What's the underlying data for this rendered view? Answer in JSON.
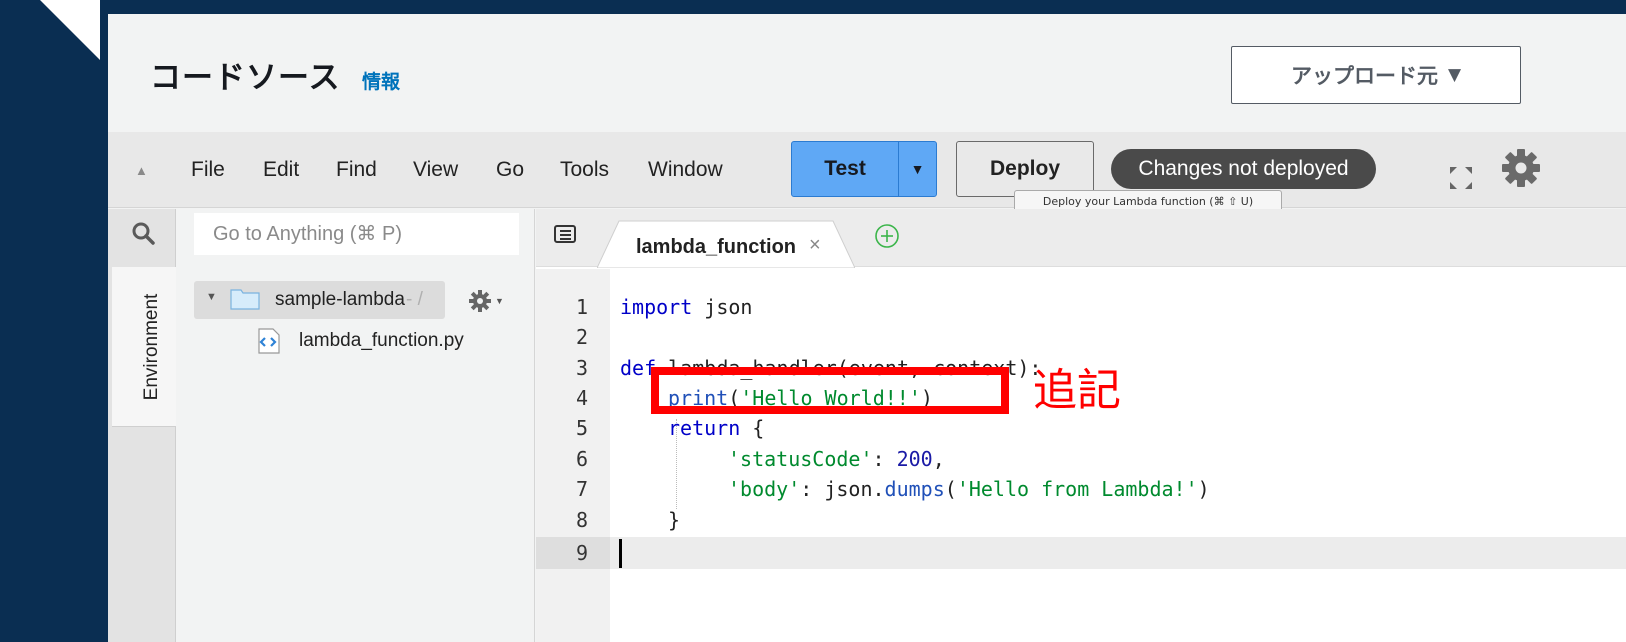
{
  "header": {
    "title": "コードソース",
    "info_link": "情報",
    "upload_label": "アップロード元"
  },
  "menu": [
    "File",
    "Edit",
    "Find",
    "View",
    "Go",
    "Tools",
    "Window"
  ],
  "toolbar": {
    "test_label": "Test",
    "deploy_label": "Deploy",
    "status_badge": "Changes not deployed",
    "deploy_tooltip": "Deploy your Lambda function (⌘ ⇧ U)"
  },
  "sidebar": {
    "environment_tab": "Environment",
    "goto_placeholder": "Go to Anything (⌘ P)"
  },
  "filetree": {
    "folder_name": "sample-lambda",
    "folder_suffix": "- /",
    "file_name": "lambda_function.py"
  },
  "editor": {
    "tab_label": "lambda_function",
    "tab_close": "×",
    "line_numbers": [
      "1",
      "2",
      "3",
      "4",
      "5",
      "6",
      "7",
      "8",
      "9"
    ],
    "code": {
      "l1_kw": "import",
      "l1_rest": " json",
      "l3_kw": "def",
      "l3_rest": " lambda_handler(event, context):",
      "l4_fn": "print",
      "l4_open": "(",
      "l4_str": "'Hello World!!'",
      "l4_close": ")",
      "l5_kw": "return",
      "l5_rest": " {",
      "l6_str": "'statusCode'",
      "l6_colon": ": ",
      "l6_num": "200",
      "l6_comma": ",",
      "l7_str": "'body'",
      "l7_mid": ": json.",
      "l7_fn": "dumps",
      "l7_open": "(",
      "l7_str2": "'Hello from Lambda!'",
      "l7_close": ")",
      "l8": "}"
    }
  },
  "annotation": {
    "text": "追記"
  },
  "colors": {
    "accent": "#5fa8f5",
    "highlight": "#ff0000",
    "background": "#0a2e52"
  }
}
